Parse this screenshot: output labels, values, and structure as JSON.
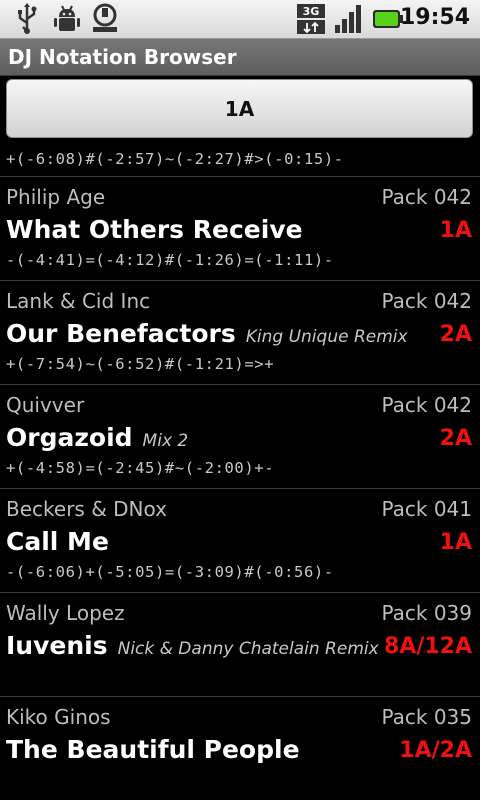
{
  "status_bar": {
    "time": "19:54",
    "icons": [
      "usb-icon",
      "debug-icon",
      "sd-card-icon",
      "3g-icon",
      "signal-icon",
      "battery-icon"
    ]
  },
  "app": {
    "title": "DJ Notation Browser"
  },
  "key_button": {
    "label": "1A"
  },
  "top_notation": "+(-6:08)#(-2:57)~(-2:27)#>(-0:15)-",
  "tracks": [
    {
      "artist": "Philip Age",
      "pack": "Pack 042",
      "title": "What Others Receive",
      "remix": "",
      "key": "1A",
      "notation": "-(-4:41)=(-4:12)#(-1:26)=(-1:11)-"
    },
    {
      "artist": "Lank & Cid Inc",
      "pack": "Pack 042",
      "title": "Our Benefactors",
      "remix": "King Unique Remix",
      "key": "2A",
      "notation": "+(-7:54)~(-6:52)#(-1:21)=>+"
    },
    {
      "artist": "Quivver",
      "pack": "Pack 042",
      "title": "Orgazoid",
      "remix": "Mix 2",
      "key": "2A",
      "notation": "+(-4:58)=(-2:45)#~(-2:00)+-"
    },
    {
      "artist": "Beckers & DNox",
      "pack": "Pack 041",
      "title": "Call Me",
      "remix": "",
      "key": "1A",
      "notation": "-(-6:06)+(-5:05)=(-3:09)#(-0:56)-"
    },
    {
      "artist": "Wally Lopez",
      "pack": "Pack 039",
      "title": "Iuvenis",
      "remix": "Nick & Danny Chatelain Remix",
      "key": "8A/12A",
      "notation": ""
    },
    {
      "artist": "Kiko Ginos",
      "pack": "Pack 035",
      "title": "The Beautiful People",
      "remix": "",
      "key": "1A/2A",
      "notation": ""
    }
  ],
  "colors": {
    "key": "#ee1111",
    "background": "#000000",
    "title_bar": "#666666"
  }
}
